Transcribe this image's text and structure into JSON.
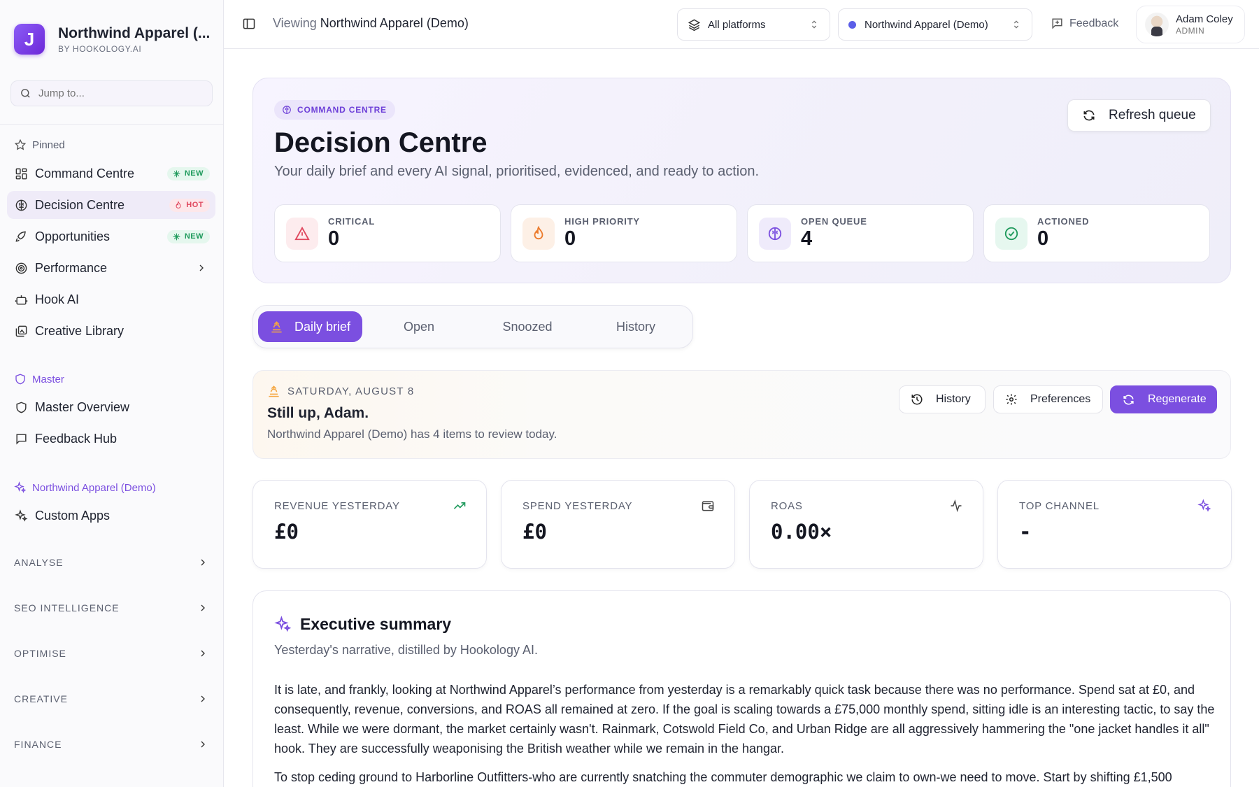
{
  "brand": {
    "logo_letter": "J",
    "name": "Northwind Apparel (...",
    "sub": "BY HOOKOLOGY.AI"
  },
  "search": {
    "placeholder": "Jump to..."
  },
  "sidebar": {
    "pinned_label": "Pinned",
    "pinned": [
      {
        "label": "Command Centre",
        "badge": "NEW",
        "icon": "grid-icon"
      },
      {
        "label": "Decision Centre",
        "badge": "HOT",
        "icon": "brain-icon",
        "active": true
      },
      {
        "label": "Opportunities",
        "badge": "NEW",
        "icon": "rocket-icon"
      },
      {
        "label": "Performance",
        "icon": "target-icon"
      },
      {
        "label": "Hook AI",
        "icon": "bot-icon"
      },
      {
        "label": "Creative Library",
        "icon": "gallery-icon"
      }
    ],
    "master_label": "Master",
    "master": [
      {
        "label": "Master Overview",
        "icon": "shield-icon"
      },
      {
        "label": "Feedback Hub",
        "icon": "message-icon"
      }
    ],
    "client_label": "Northwind Apparel (Demo)",
    "client": [
      {
        "label": "Custom Apps",
        "icon": "sparkles-icon"
      }
    ],
    "groups": [
      "ANALYSE",
      "SEO INTELLIGENCE",
      "OPTIMISE",
      "CREATIVE",
      "FINANCE"
    ]
  },
  "topbar": {
    "viewing_prefix": "Viewing",
    "viewing_name": "Northwind Apparel (Demo)",
    "platform_select": "All platforms",
    "account_select": "Northwind Apparel (Demo)",
    "feedback": "Feedback",
    "user_name": "Adam Coley",
    "user_role": "ADMIN"
  },
  "hero": {
    "crumb": "COMMAND CENTRE",
    "title": "Decision Centre",
    "subtitle": "Your daily brief and every AI signal, prioritised, evidenced, and ready to action.",
    "refresh_label": "Refresh queue",
    "stats": [
      {
        "label": "CRITICAL",
        "value": "0"
      },
      {
        "label": "HIGH PRIORITY",
        "value": "0"
      },
      {
        "label": "OPEN QUEUE",
        "value": "4"
      },
      {
        "label": "ACTIONED",
        "value": "0"
      }
    ]
  },
  "tabs": [
    "Daily brief",
    "Open",
    "Snoozed",
    "History"
  ],
  "brief": {
    "date": "SATURDAY, AUGUST 8",
    "title": "Still up, Adam.",
    "subtitle": "Northwind Apparel (Demo) has 4 items to review today.",
    "buttons": {
      "history": "History",
      "preferences": "Preferences",
      "regenerate": "Regenerate"
    }
  },
  "kpis": [
    {
      "label": "REVENUE YESTERDAY",
      "value": "£0",
      "icon": "trending-up-icon"
    },
    {
      "label": "SPEND YESTERDAY",
      "value": "£0",
      "icon": "wallet-icon"
    },
    {
      "label": "ROAS",
      "value": "0.00×",
      "icon": "activity-icon"
    },
    {
      "label": "TOP CHANNEL",
      "value": "-",
      "icon": "sparkles-icon"
    }
  ],
  "summary": {
    "title": "Executive summary",
    "subtitle": "Yesterday's narrative, distilled by Hookology AI.",
    "p1": "It is late, and frankly, looking at Northwind Apparel’s performance from yesterday is a remarkably quick task because there was no performance. Spend sat at £0, and consequently, revenue, conversions, and ROAS all remained at zero. If the goal is scaling towards a £75,000 monthly spend, sitting idle is an interesting tactic, to say the least. While we were dormant, the market certainly wasn't. Rainmark, Cotswold Field Co, and Urban Ridge are all aggressively hammering the \"one jacket handles it all\" hook. They are successfully weaponising the British weather while we remain in the hangar.",
    "p2": "To stop ceding ground to Harborline Outfitters-who are currently snatching the commuter demographic we claim to own-we need to move. Start by shifting £1,500"
  },
  "colors": {
    "accent": "#7b4fe0",
    "new_badge": "#1f9a5c",
    "hot_badge": "#e0485e"
  }
}
